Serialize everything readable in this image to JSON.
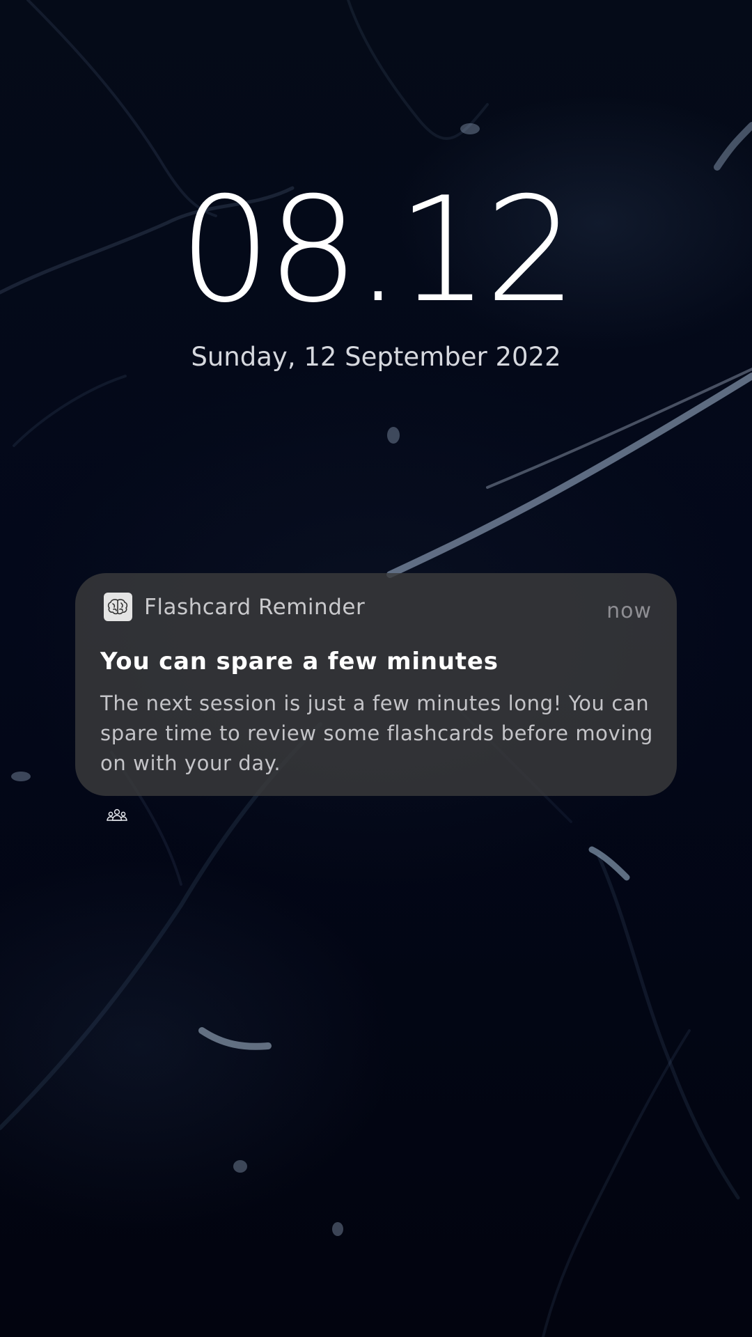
{
  "lockscreen": {
    "time": "08.12",
    "date": "Sunday, 12 September 2022"
  },
  "notification": {
    "app_icon": "brain-icon",
    "app_name": "Flashcard Reminder",
    "time_ago": "now",
    "title": "You can spare a few minutes",
    "body": "The next session is just a few minutes long! You can spare time to review some flashcards before moving on with your day."
  },
  "footer": {
    "icon": "people-group-icon"
  },
  "colors": {
    "background": "#03081a",
    "notification_bg": "#3a3a3c",
    "text_primary": "#ffffff",
    "text_secondary": "#c4c4c8",
    "text_muted": "#8e8e93"
  }
}
